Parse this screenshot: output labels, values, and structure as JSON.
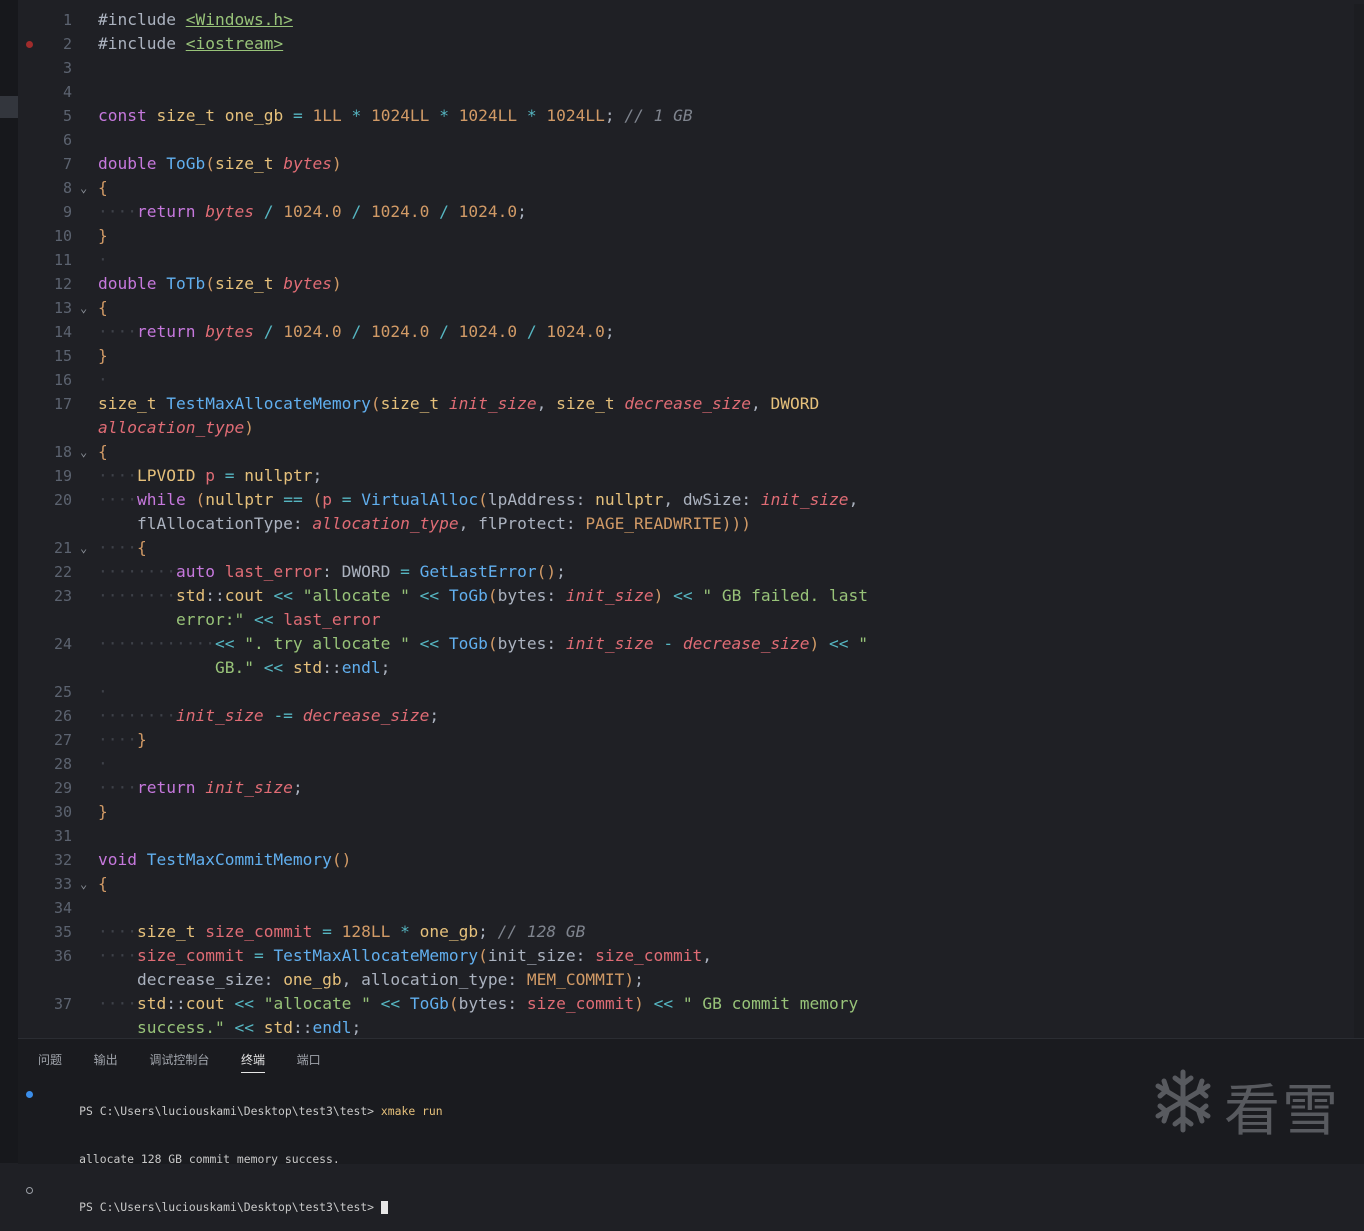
{
  "editor": {
    "lines": [
      {
        "n": "1",
        "html": "<span class=\"h\">#include</span> <span class=\"inc\">&lt;Windows.h&gt;</span>"
      },
      {
        "n": "2",
        "bp": true,
        "html": "<span class=\"h\">#include</span> <span class=\"inc\">&lt;iostream&gt;</span>"
      },
      {
        "n": "3",
        "html": ""
      },
      {
        "n": "4",
        "html": ""
      },
      {
        "n": "5",
        "html": "<span class=\"k\">const</span> <span class=\"t\">size_t</span> <span class=\"t\">one_gb</span> <span class=\"o\">=</span> <span class=\"n\">1LL</span> <span class=\"o\">*</span> <span class=\"n\">1024LL</span> <span class=\"o\">*</span> <span class=\"n\">1024LL</span> <span class=\"o\">*</span> <span class=\"n\">1024LL</span><span class=\"pn\">;</span> <span class=\"c\">// 1 GB</span>"
      },
      {
        "n": "6",
        "html": ""
      },
      {
        "n": "7",
        "html": "<span class=\"k\">double</span> <span class=\"f\">ToGb</span><span class=\"br\">(</span><span class=\"t\">size_t</span> <span class=\"p\">bytes</span><span class=\"br\">)</span>"
      },
      {
        "n": "8",
        "fold": true,
        "html": "<span class=\"br\">{</span>"
      },
      {
        "n": "9",
        "html": "<span class=\"ind\">····</span><span class=\"k\">return</span> <span class=\"p\">bytes</span> <span class=\"o\">/</span> <span class=\"n\">1024.0</span> <span class=\"o\">/</span> <span class=\"n\">1024.0</span> <span class=\"o\">/</span> <span class=\"n\">1024.0</span><span class=\"pn\">;</span>"
      },
      {
        "n": "10",
        "html": "<span class=\"br\">}</span>"
      },
      {
        "n": "11",
        "html": "<span class=\"ind\">·</span>"
      },
      {
        "n": "12",
        "html": "<span class=\"k\">double</span> <span class=\"f\">ToTb</span><span class=\"br\">(</span><span class=\"t\">size_t</span> <span class=\"p\">bytes</span><span class=\"br\">)</span>"
      },
      {
        "n": "13",
        "fold": true,
        "html": "<span class=\"br\">{</span>"
      },
      {
        "n": "14",
        "html": "<span class=\"ind\">····</span><span class=\"k\">return</span> <span class=\"p\">bytes</span> <span class=\"o\">/</span> <span class=\"n\">1024.0</span> <span class=\"o\">/</span> <span class=\"n\">1024.0</span> <span class=\"o\">/</span> <span class=\"n\">1024.0</span> <span class=\"o\">/</span> <span class=\"n\">1024.0</span><span class=\"pn\">;</span>"
      },
      {
        "n": "15",
        "html": "<span class=\"br\">}</span>"
      },
      {
        "n": "16",
        "html": "<span class=\"ind\">·</span>"
      },
      {
        "n": "17",
        "html": "<span class=\"t\">size_t</span> <span class=\"f\">TestMaxAllocateMemory</span><span class=\"br\">(</span><span class=\"t\">size_t</span> <span class=\"p\">init_size</span><span class=\"pn\">,</span> <span class=\"t\">size_t</span> <span class=\"p\">decrease_size</span><span class=\"pn\">,</span> <span class=\"t\">DWORD</span>"
      },
      {
        "n": "",
        "html": "<span class=\"p\">allocation_type</span><span class=\"br\">)</span>"
      },
      {
        "n": "18",
        "fold": true,
        "html": "<span class=\"br\">{</span>"
      },
      {
        "n": "19",
        "html": "<span class=\"ind\">····</span><span class=\"t\">LPVOID</span> <span class=\"v\">p</span> <span class=\"o\">=</span> <span class=\"t\">nullptr</span><span class=\"pn\">;</span>"
      },
      {
        "n": "20",
        "html": "<span class=\"ind\">····</span><span class=\"k\">while</span> <span class=\"br\">(</span><span class=\"t\">nullptr</span> <span class=\"o\">==</span> <span class=\"br\">(</span><span class=\"v\">p</span> <span class=\"o\">=</span> <span class=\"f\">VirtualAlloc</span><span class=\"br\">(</span><span class=\"h\">lpAddress:</span> <span class=\"t\">nullptr</span><span class=\"pn\">,</span> <span class=\"h\">dwSize:</span> <span class=\"p\">init_size</span><span class=\"pn\">,</span>"
      },
      {
        "n": "",
        "html": "    <span class=\"h\">flAllocationType:</span> <span class=\"p\">allocation_type</span><span class=\"pn\">,</span> <span class=\"h\">flProtect:</span> <span class=\"m\">PAGE_READWRITE</span><span class=\"br\">)))</span>"
      },
      {
        "n": "21",
        "fold": true,
        "html": "<span class=\"ind\">····</span><span class=\"br\">{</span>"
      },
      {
        "n": "22",
        "html": "<span class=\"ind\">········</span><span class=\"k\">auto</span> <span class=\"v\">last_error</span><span class=\"h\">: DWORD</span> <span class=\"o\">=</span> <span class=\"f\">GetLastError</span><span class=\"br\">()</span><span class=\"pn\">;</span>"
      },
      {
        "n": "23",
        "html": "<span class=\"ind\">········</span><span class=\"t\">std</span><span class=\"pn\">::</span><span class=\"t\">cout</span> <span class=\"o\">&lt;&lt;</span> <span class=\"s\">\"allocate \"</span> <span class=\"o\">&lt;&lt;</span> <span class=\"f\">ToGb</span><span class=\"br\">(</span><span class=\"h\">bytes:</span> <span class=\"p\">init_size</span><span class=\"br\">)</span> <span class=\"o\">&lt;&lt;</span> <span class=\"s\">\" GB failed. last</span>"
      },
      {
        "n": "",
        "html": "        <span class=\"s\">error:\"</span> <span class=\"o\">&lt;&lt;</span> <span class=\"v\">last_error</span>"
      },
      {
        "n": "24",
        "html": "<span class=\"ind\">············</span><span class=\"o\">&lt;&lt;</span> <span class=\"s\">\". try allocate \"</span> <span class=\"o\">&lt;&lt;</span> <span class=\"f\">ToGb</span><span class=\"br\">(</span><span class=\"h\">bytes:</span> <span class=\"p\">init_size</span> <span class=\"o\">-</span> <span class=\"p\">decrease_size</span><span class=\"br\">)</span> <span class=\"o\">&lt;&lt;</span> <span class=\"s\">\"</span>"
      },
      {
        "n": "",
        "html": "            <span class=\"s\">GB.\"</span> <span class=\"o\">&lt;&lt;</span> <span class=\"t\">std</span><span class=\"pn\">::</span><span class=\"f\">endl</span><span class=\"pn\">;</span>"
      },
      {
        "n": "25",
        "html": "<span class=\"ind\">·</span>"
      },
      {
        "n": "26",
        "html": "<span class=\"ind\">········</span><span class=\"p\">init_size</span> <span class=\"o\">-=</span> <span class=\"p\">decrease_size</span><span class=\"pn\">;</span>"
      },
      {
        "n": "27",
        "html": "<span class=\"ind\">····</span><span class=\"br\">}</span>"
      },
      {
        "n": "28",
        "html": "<span class=\"ind\">·</span>"
      },
      {
        "n": "29",
        "html": "<span class=\"ind\">····</span><span class=\"k\">return</span> <span class=\"p\">init_size</span><span class=\"pn\">;</span>"
      },
      {
        "n": "30",
        "html": "<span class=\"br\">}</span>"
      },
      {
        "n": "31",
        "html": ""
      },
      {
        "n": "32",
        "html": "<span class=\"k\">void</span> <span class=\"f\">TestMaxCommitMemory</span><span class=\"br\">()</span>"
      },
      {
        "n": "33",
        "fold": true,
        "html": "<span class=\"br\">{</span>"
      },
      {
        "n": "34",
        "html": ""
      },
      {
        "n": "35",
        "html": "<span class=\"ind\">····</span><span class=\"t\">size_t</span> <span class=\"v\">size_commit</span> <span class=\"o\">=</span> <span class=\"n\">128LL</span> <span class=\"o\">*</span> <span class=\"t\">one_gb</span><span class=\"pn\">;</span> <span class=\"c\">// 128 GB</span>"
      },
      {
        "n": "36",
        "html": "<span class=\"ind\">····</span><span class=\"v\">size_commit</span> <span class=\"o\">=</span> <span class=\"f\">TestMaxAllocateMemory</span><span class=\"br\">(</span><span class=\"h\">init_size:</span> <span class=\"v\">size_commit</span><span class=\"pn\">,</span>"
      },
      {
        "n": "",
        "html": "    <span class=\"h\">decrease_size:</span> <span class=\"t\">one_gb</span><span class=\"pn\">,</span> <span class=\"h\">allocation_type:</span> <span class=\"m\">MEM_COMMIT</span><span class=\"br\">)</span><span class=\"pn\">;</span>"
      },
      {
        "n": "37",
        "html": "<span class=\"ind\">····</span><span class=\"t\">std</span><span class=\"pn\">::</span><span class=\"t\">cout</span> <span class=\"o\">&lt;&lt;</span> <span class=\"s\">\"allocate \"</span> <span class=\"o\">&lt;&lt;</span> <span class=\"f\">ToGb</span><span class=\"br\">(</span><span class=\"h\">bytes:</span> <span class=\"v\">size_commit</span><span class=\"br\">)</span> <span class=\"o\">&lt;&lt;</span> <span class=\"s\">\" GB commit memory</span>"
      },
      {
        "n": "",
        "html": "    <span class=\"s\">success.\"</span> <span class=\"o\">&lt;&lt;</span> <span class=\"t\">std</span><span class=\"pn\">::</span><span class=\"f\">endl</span><span class=\"pn\">;</span>"
      }
    ]
  },
  "panel": {
    "tabs": [
      {
        "label": "问题",
        "active": false
      },
      {
        "label": "输出",
        "active": false
      },
      {
        "label": "调试控制台",
        "active": false
      },
      {
        "label": "终端",
        "active": true
      },
      {
        "label": "端口",
        "active": false
      }
    ]
  },
  "terminal": {
    "prompt1": "PS C:\\Users\\luciouskami\\Desktop\\test3\\test> ",
    "command": "xmake run",
    "output": "allocate 128 GB commit memory success.",
    "prompt2": "PS C:\\Users\\luciouskami\\Desktop\\test3\\test> "
  },
  "watermark": {
    "text": "看雪",
    "icon": "snowflake-icon"
  },
  "colors": {
    "background": "#1f2025",
    "keyword": "#c678dd",
    "type": "#e5c07b",
    "function": "#61afef",
    "param": "#e06c75",
    "number": "#d19a66",
    "string": "#98c379",
    "comment": "#7f848e"
  }
}
